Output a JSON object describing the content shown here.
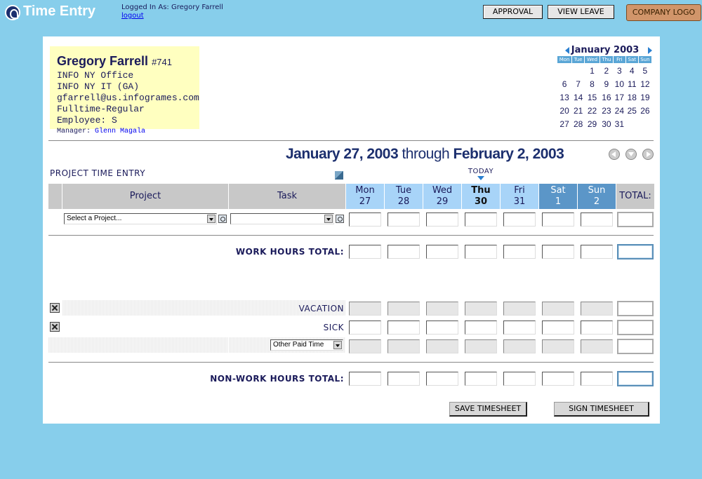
{
  "header": {
    "app_title": "Time Entry",
    "logged_in_label": "Logged In As: Gregory Farrell",
    "logout_label": "logout",
    "approval_label": "APPROVAL",
    "view_leave_label": "VIEW LEAVE",
    "company_logo_label": "COMPANY LOGO"
  },
  "employee": {
    "name": "Gregory Farrell",
    "number": "#741",
    "office": "INFO NY Office",
    "department": "INFO NY IT (GA)",
    "email": "gfarrell@us.infogrames.com",
    "type": "Fulltime-Regular Employee: S",
    "manager_label": "Manager:",
    "manager_name": "Glenn Magala"
  },
  "calendar": {
    "month_label": "January 2003",
    "weekdays": [
      "Mon",
      "Tue",
      "Wed",
      "Thu",
      "Fri",
      "Sat",
      "Sun"
    ],
    "weeks": [
      [
        "",
        "",
        "",
        "1",
        "2",
        "3",
        "4",
        "5"
      ],
      [
        "6",
        "7",
        "8",
        "9",
        "10",
        "11",
        "12"
      ],
      [
        "13",
        "14",
        "15",
        "16",
        "17",
        "18",
        "19"
      ],
      [
        "20",
        "21",
        "22",
        "23",
        "24",
        "25",
        "26"
      ],
      [
        "27",
        "28",
        "29",
        "30",
        "31",
        "",
        ""
      ]
    ]
  },
  "range": {
    "start": "January 27, 2003",
    "through": "through",
    "end": "February 2, 2003"
  },
  "timesheet": {
    "section_title": "PROJECT TIME ENTRY",
    "today_label": "TODAY",
    "project_header": "Project",
    "task_header": "Task",
    "total_header": "TOTAL:",
    "days": [
      {
        "name": "Mon",
        "date": "27"
      },
      {
        "name": "Tue",
        "date": "28"
      },
      {
        "name": "Wed",
        "date": "29"
      },
      {
        "name": "Thu",
        "date": "30"
      },
      {
        "name": "Fri",
        "date": "31"
      },
      {
        "name": "Sat",
        "date": "1"
      },
      {
        "name": "Sun",
        "date": "2"
      }
    ],
    "project_select": "Select a Project...",
    "task_select": "",
    "work_total_label": "WORK HOURS TOTAL:",
    "vacation_label": "VACATION",
    "sick_label": "SICK",
    "other_paid_select": "Other Paid Time",
    "nonwork_total_label": "NON-WORK HOURS TOTAL:",
    "save_label": "SAVE TIMESHEET",
    "sign_label": "SIGN TIMESHEET"
  }
}
